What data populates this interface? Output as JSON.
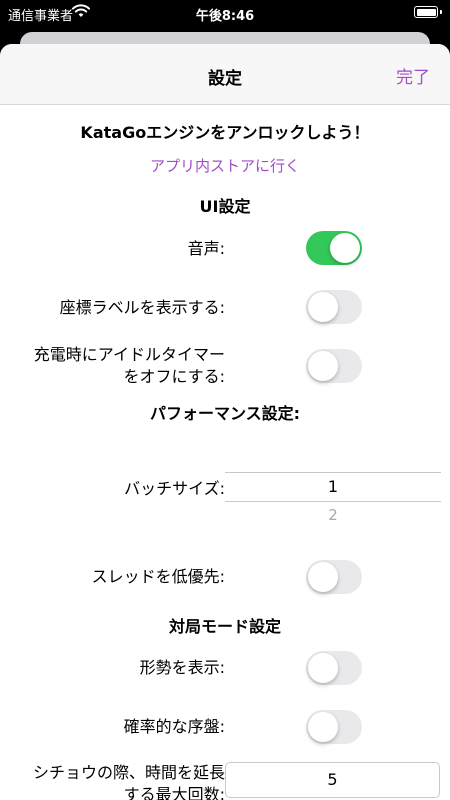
{
  "status_bar": {
    "carrier": "通信事業者",
    "time": "午後8:46"
  },
  "nav": {
    "title": "設定",
    "done_label": "完了"
  },
  "unlock": {
    "heading": "KataGoエンジンをアンロックしよう！",
    "store_link": "アプリ内ストアに行く"
  },
  "ui_settings": {
    "heading": "UI設定",
    "sound": {
      "label": "音声:",
      "on": true
    },
    "coord_labels": {
      "label": "座標ラベルを表示する:",
      "on": false
    },
    "idle_timer": {
      "label_line1": "充電時にアイドルタイマー",
      "label_line2": "をオフにする:",
      "on": false
    }
  },
  "performance": {
    "heading": "パフォーマンス設定:",
    "batch_size": {
      "label": "バッチサイズ:",
      "selected": "1",
      "next": "2"
    },
    "low_priority_thread": {
      "label": "スレッドを低優先:",
      "on": false
    }
  },
  "game_mode": {
    "heading": "対局モード設定",
    "show_ownership": {
      "label": "形勢を表示:",
      "on": false
    },
    "random_opening": {
      "label": "確率的な序盤:",
      "on": false
    },
    "ladder_extension": {
      "label_line1": "シチョウの際、時間を延長",
      "label_line2": "する最大回数:",
      "value": "5"
    }
  },
  "colors": {
    "accent": "#a24dc7",
    "toggle_on": "#34c759",
    "toggle_off": "#e9e9eb"
  }
}
